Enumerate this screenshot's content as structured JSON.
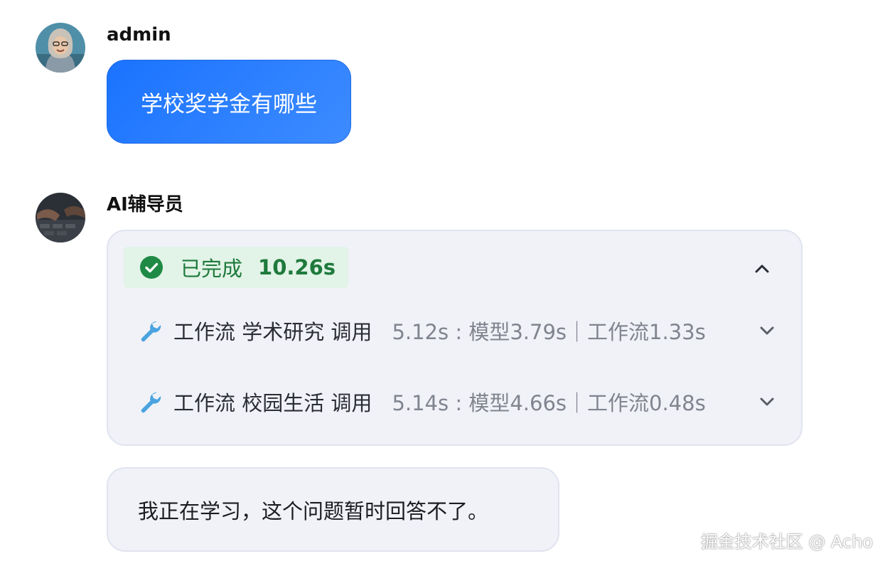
{
  "user_message": {
    "sender": "admin",
    "text": "学校奖学金有哪些"
  },
  "ai_message": {
    "sender": "AI辅导员",
    "status": {
      "label": "已完成",
      "time": "10.26s"
    },
    "tool_calls": [
      {
        "name": "工作流 学术研究 调用",
        "timing": "5.12s : 模型3.79s｜工作流1.33s"
      },
      {
        "name": "工作流 校园生活 调用",
        "timing": "5.14s : 模型4.66s｜工作流0.48s"
      }
    ],
    "reply": "我正在学习，这个问题暂时回答不了。"
  },
  "watermark": "掘金技术社区 @ Acho",
  "colors": {
    "user_bubble": "#1a73ff",
    "card_background": "#f0f2f8",
    "success": "#1e7a3c",
    "wrench": "#4aa3df"
  },
  "icons": {
    "status": "check-circle-icon",
    "tool": "wrench-icon",
    "collapse": "chevron-up-icon",
    "expand": "chevron-down-icon"
  }
}
